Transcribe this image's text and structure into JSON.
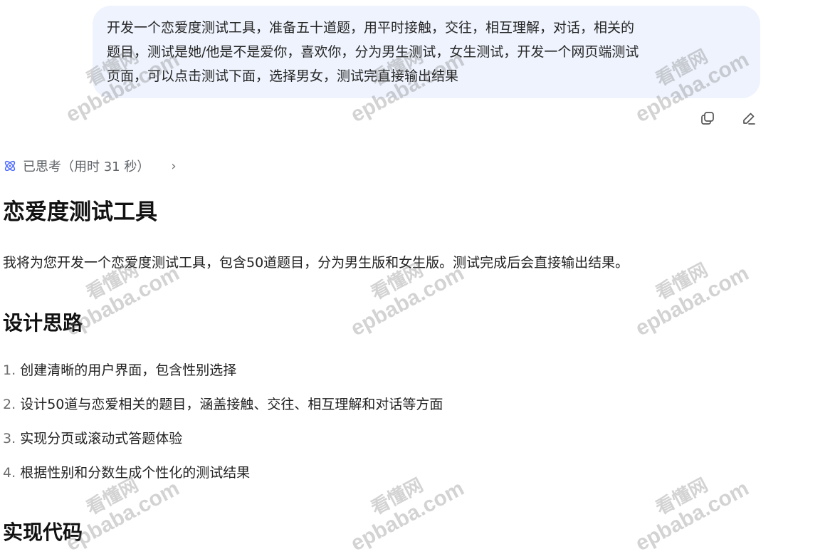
{
  "user_message": {
    "line1": "开发一个恋爱度测试工具，准备五十道题，用平时接触，交往，相互理解，对话，相关的",
    "line2": "题目，测试是她/他是不是爱你，喜欢你，分为男生测试，女生测试，开发一个网页端测试",
    "line3": "页面，可以点击测试下面，选择男女，测试完直接输出结果"
  },
  "message_actions": {
    "copy_icon": "copy-icon",
    "edit_icon": "pencil-icon"
  },
  "thinking": {
    "label": "已思考（用时 31 秒）",
    "icon": "atom-icon",
    "chevron": "›",
    "icon_color": "#4d6bfe"
  },
  "answer": {
    "title": "恋爱度测试工具",
    "intro": "我将为您开发一个恋爱度测试工具，包含50道题目，分为男生版和女生版。测试完成后会直接输出结果。",
    "design_heading": "设计思路",
    "steps": [
      {
        "num": "1.",
        "text": "创建清晰的用户界面，包含性别选择"
      },
      {
        "num": "2.",
        "text": "设计50道与恋爱相关的题目，涵盖接触、交往、相互理解和对话等方面"
      },
      {
        "num": "3.",
        "text": "实现分页或滚动式答题体验"
      },
      {
        "num": "4.",
        "text": "根据性别和分数生成个性化的测试结果"
      }
    ],
    "code_heading": "实现代码"
  },
  "watermark": {
    "cn": "看懂网",
    "en": "epbaba.com"
  },
  "colors": {
    "bubble_bg": "#eef3fd",
    "text": "#1f1f1f",
    "muted": "#6b6b6b"
  }
}
